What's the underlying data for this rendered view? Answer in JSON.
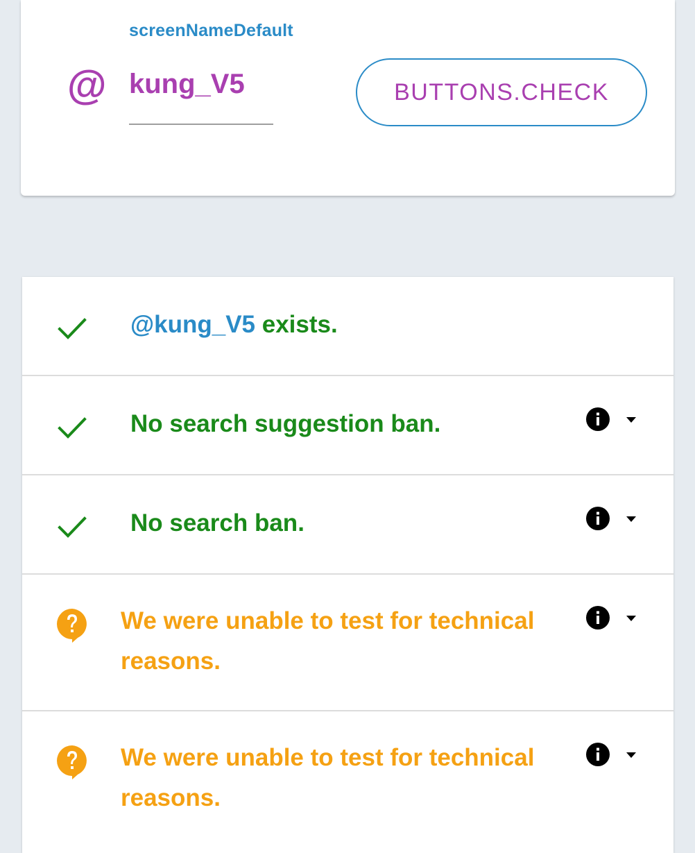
{
  "lookup": {
    "label": "screenNameDefault",
    "at_symbol": "@",
    "screen_name": "kung_V5",
    "check_button": "BUTTONS.CHECK"
  },
  "results": [
    {
      "status": "ok",
      "icon": "checkmark-icon",
      "handle": "@kung_V5",
      "text": " exists."
    },
    {
      "status": "ok",
      "icon": "checkmark-icon",
      "text": "No search suggestion ban.",
      "has_info": true
    },
    {
      "status": "ok",
      "icon": "checkmark-icon",
      "text": "No search ban.",
      "has_info": true
    },
    {
      "status": "unknown",
      "icon": "question-bubble-icon",
      "line1": "We were unable to test for technical",
      "line2": "reasons.",
      "has_info": true
    },
    {
      "status": "unknown",
      "icon": "question-bubble-icon",
      "line1": "We were unable to test for technical",
      "line2": "reasons.",
      "has_info": true
    }
  ],
  "colors": {
    "accent_purple": "#a93fb0",
    "accent_blue": "#2a8bc7",
    "success_green": "#1a8a1a",
    "warning_orange": "#f5a113",
    "background": "#e6ebf0"
  }
}
